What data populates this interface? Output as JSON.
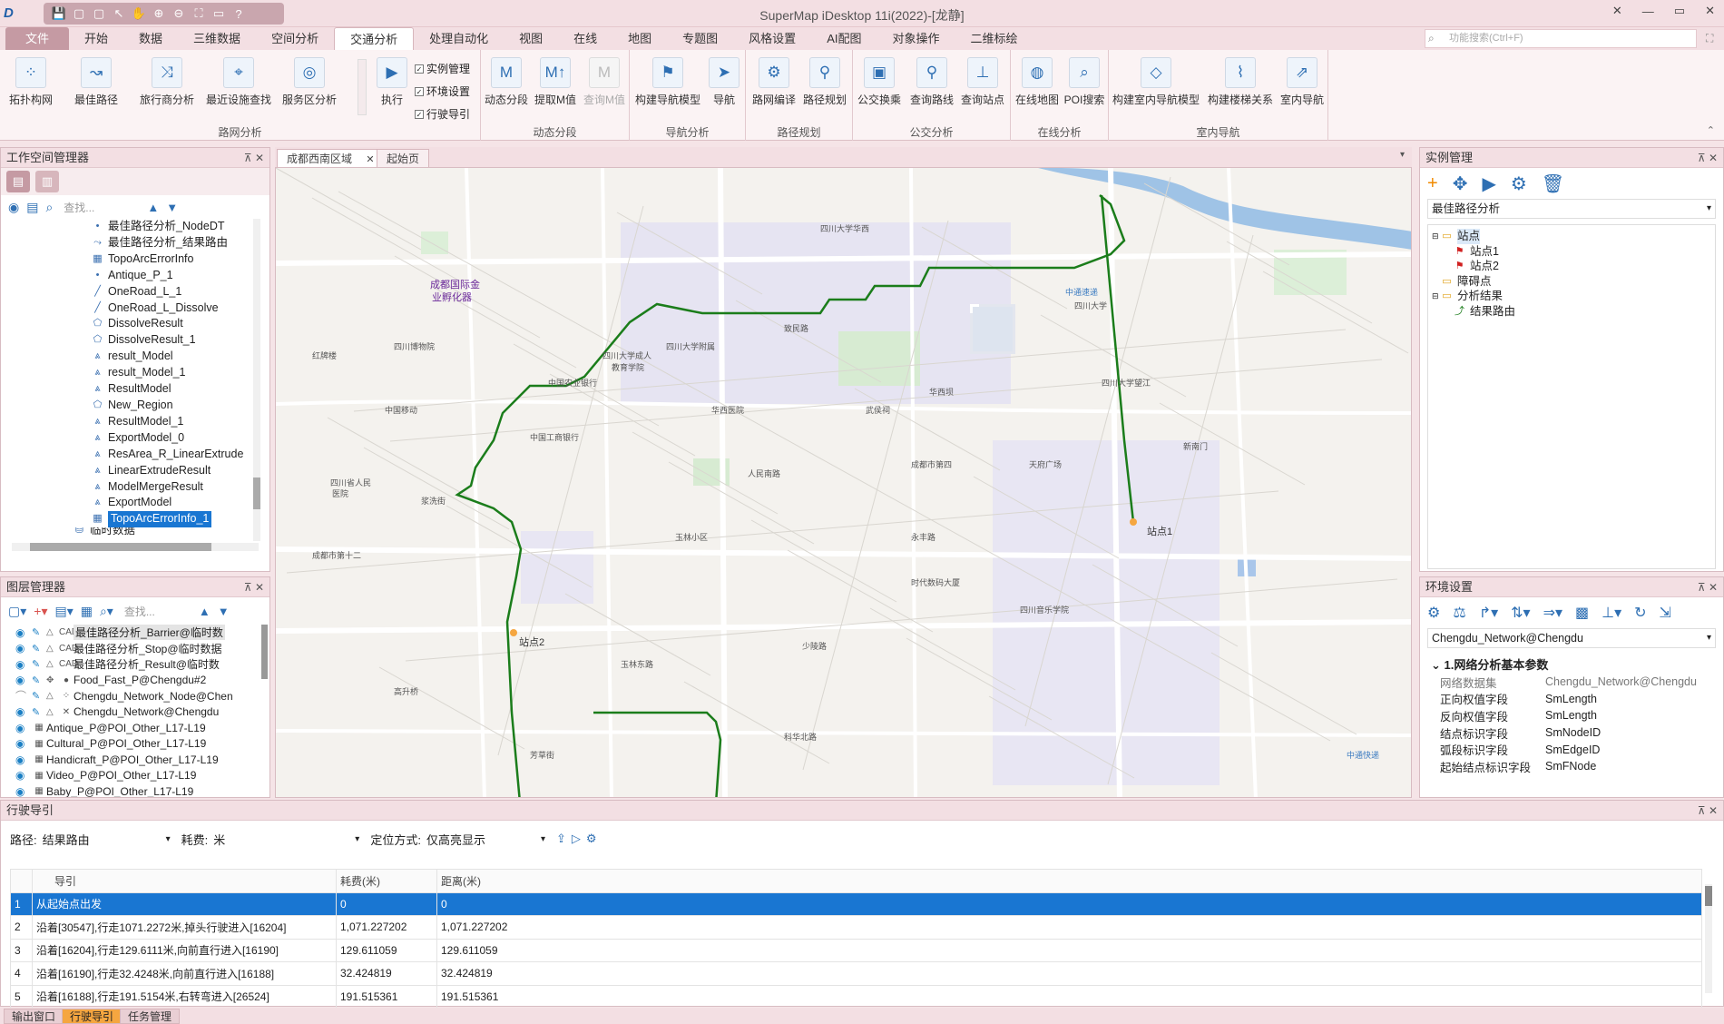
{
  "app": {
    "title": "SuperMap iDesktop 11i(2022)-[龙静]",
    "logo": "D",
    "win_controls": [
      "✕",
      "—",
      "▭",
      "✕"
    ]
  },
  "qat": [
    "💾",
    "▢",
    "▢",
    "↖",
    "✋",
    "⊕",
    "⊖",
    "⛶",
    "▭",
    "?"
  ],
  "menu": [
    "文件",
    "开始",
    "数据",
    "三维数据",
    "空间分析",
    "交通分析",
    "处理自动化",
    "视图",
    "在线",
    "地图",
    "专题图",
    "风格设置",
    "AI配图",
    "对象操作",
    "二维标绘"
  ],
  "function_search": {
    "placeholder": "功能搜索(Ctrl+F)"
  },
  "ribbon": {
    "groups": [
      {
        "label": "路网分析",
        "buttons": [
          "拓扑构网",
          "最佳路径",
          "旅行商分析",
          "最近设施查找",
          "服务区分析",
          "执行"
        ]
      },
      {
        "label": "动态分段",
        "buttons": [
          "动态分段",
          "提取M值",
          "查询M值"
        ]
      },
      {
        "label": "导航分析",
        "buttons": [
          "构建导航模型",
          "导航"
        ]
      },
      {
        "label": "路径规划",
        "buttons": [
          "路网编译",
          "路径规划"
        ]
      },
      {
        "label": "公交分析",
        "buttons": [
          "公交换乘",
          "查询路线",
          "查询站点"
        ]
      },
      {
        "label": "在线分析",
        "buttons": [
          "在线地图",
          "POI搜索"
        ]
      },
      {
        "label": "室内导航",
        "buttons": [
          "构建室内导航模型",
          "构建楼梯关系",
          "室内导航"
        ]
      }
    ],
    "checkboxes": [
      "实例管理",
      "环境设置",
      "行驶导引"
    ]
  },
  "workspace": {
    "title": "工作空间管理器",
    "search_placeholder": "查找...",
    "items": [
      "最佳路径分析_NodeDT",
      "最佳路径分析_结果路由",
      "TopoArcErrorInfo",
      "Antique_P_1",
      "OneRoad_L_1",
      "OneRoad_L_Dissolve",
      "DissolveResult",
      "DissolveResult_1",
      "result_Model",
      "result_Model_1",
      "ResultModel",
      "New_Region",
      "ResultModel_1",
      "ExportModel_0",
      "ResArea_R_LinearExtrude",
      "LinearExtrudeResult",
      "ModelMergeResult",
      "ExportModel",
      "TopoArcErrorInfo_1",
      "临时数据"
    ]
  },
  "layers": {
    "title": "图层管理器",
    "search_placeholder": "查找...",
    "items": [
      "最佳路径分析_Barrier@临时数",
      "最佳路径分析_Stop@临时数据",
      "最佳路径分析_Result@临时数",
      "Food_Fast_P@Chengdu#2",
      "Chengdu_Network_Node@Chen",
      "Chengdu_Network@Chengdu",
      "Antique_P@POI_Other_L17-L19",
      "Cultural_P@POI_Other_L17-L19",
      "Handicraft_P@POI_Other_L17-L19",
      "Video_P@POI_Other_L17-L19",
      "Baby_P@POI_Other_L17-L19"
    ]
  },
  "map": {
    "tabs": [
      "成都西南区域",
      "起始页"
    ],
    "route_color": "#1b7d1b",
    "labels": [
      {
        "t": "成都国际金",
        "c": "big"
      },
      {
        "t": "业孵化器",
        "c": "big"
      },
      {
        "t": "四川大学",
        "c": ""
      },
      {
        "t": "四川大学华西",
        "c": ""
      },
      {
        "t": "中通速递",
        "c": "blue"
      },
      {
        "t": "四川博物院",
        "c": ""
      },
      {
        "t": "武侯祠",
        "c": ""
      },
      {
        "t": "华西坝",
        "c": ""
      },
      {
        "t": "人民南路",
        "c": ""
      },
      {
        "t": "成都市第四",
        "c": ""
      },
      {
        "t": "天府广场",
        "c": ""
      },
      {
        "t": "中国工商银行",
        "c": ""
      },
      {
        "t": "四川大学成人",
        "c": ""
      },
      {
        "t": "教育学院",
        "c": ""
      },
      {
        "t": "四川大学附属",
        "c": ""
      },
      {
        "t": "中国移动",
        "c": ""
      },
      {
        "t": "浆洗街",
        "c": ""
      },
      {
        "t": "玉林小区",
        "c": ""
      },
      {
        "t": "玉林东路",
        "c": ""
      },
      {
        "t": "科华北路",
        "c": ""
      },
      {
        "t": "时代数码大厦",
        "c": ""
      },
      {
        "t": "四川音乐学院",
        "c": ""
      },
      {
        "t": "四川大学望江",
        "c": ""
      },
      {
        "t": "致民路",
        "c": ""
      },
      {
        "t": "成都市第十二",
        "c": ""
      },
      {
        "t": "新南门",
        "c": ""
      },
      {
        "t": "四川省人民",
        "c": ""
      },
      {
        "t": "医院",
        "c": ""
      },
      {
        "t": "红牌楼",
        "c": ""
      },
      {
        "t": "中国农业银行",
        "c": ""
      },
      {
        "t": "少陵路",
        "c": ""
      },
      {
        "t": "高升桥",
        "c": ""
      },
      {
        "t": "芳草街",
        "c": ""
      },
      {
        "t": "永丰路",
        "c": ""
      },
      {
        "t": "华西医院",
        "c": ""
      },
      {
        "t": "中通快递",
        "c": "blue"
      }
    ],
    "stops": [
      "站点1",
      "站点2"
    ]
  },
  "instance": {
    "title": "实例管理",
    "combo": "最佳路径分析",
    "tree": [
      "站点",
      "站点1",
      "站点2",
      "障碍点",
      "分析结果",
      "结果路由"
    ]
  },
  "env": {
    "title": "环境设置",
    "combo": "Chengdu_Network@Chengdu",
    "section": "1.网络分析基本参数",
    "props": [
      {
        "k": "网络数据集",
        "v": "Chengdu_Network@Chengdu"
      },
      {
        "k": "正向权值字段",
        "v": "SmLength"
      },
      {
        "k": "反向权值字段",
        "v": "SmLength"
      },
      {
        "k": "结点标识字段",
        "v": "SmNodeID"
      },
      {
        "k": "弧段标识字段",
        "v": "SmEdgeID"
      },
      {
        "k": "起始结点标识字段",
        "v": "SmFNode"
      }
    ]
  },
  "guide": {
    "title": "行驶导引",
    "path_label": "路径:",
    "path_value": "结果路由",
    "cost_label": "耗费:",
    "cost_value": "米",
    "locate_label": "定位方式:",
    "locate_value": "仅高亮显示",
    "columns": [
      "导引",
      "耗费(米)",
      "距离(米)"
    ],
    "rows": [
      {
        "n": "1",
        "g": "从起始点出发",
        "c": "0",
        "d": "0"
      },
      {
        "n": "2",
        "g": "沿着[30547],行走1071.2272米,掉头行驶进入[16204]",
        "c": "1,071.227202",
        "d": "1,071.227202"
      },
      {
        "n": "3",
        "g": "沿着[16204],行走129.6111米,向前直行进入[16190]",
        "c": "129.611059",
        "d": "129.611059"
      },
      {
        "n": "4",
        "g": "沿着[16190],行走32.4248米,向前直行进入[16188]",
        "c": "32.424819",
        "d": "32.424819"
      },
      {
        "n": "5",
        "g": "沿着[16188],行走191.5154米,右转弯进入[26524]",
        "c": "191.515361",
        "d": "191.515361"
      }
    ]
  },
  "bottom_tabs": [
    "输出窗口",
    "行驶导引",
    "任务管理"
  ]
}
